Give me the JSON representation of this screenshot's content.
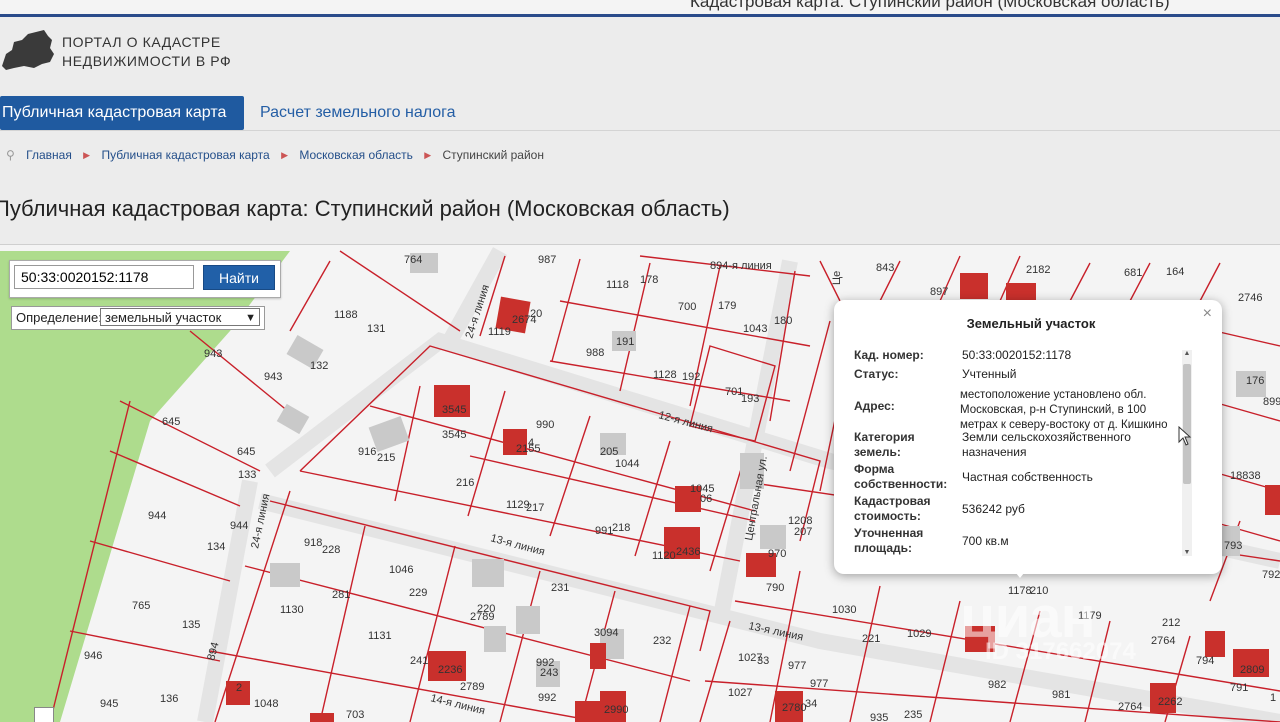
{
  "topbar": {
    "cut_text": "Кадастровая карта: Ступинский район (Московская область)"
  },
  "portal": {
    "line1": "ПОРТАЛ О КАДАСТРЕ",
    "line2": "НЕДВИЖИМОСТИ В РФ"
  },
  "nav": {
    "tabs": [
      {
        "label": "Публичная кадастровая карта",
        "active": true
      },
      {
        "label": "Расчет земельного налога",
        "active": false
      }
    ]
  },
  "breadcrumbs": [
    "Главная",
    "Публичная кадастровая карта",
    "Московская область",
    "Ступинский район"
  ],
  "page_title": "Публичная кадастровая карта: Ступинский район (Московская область)",
  "search": {
    "value": "50:33:0020152:1178",
    "button_label": "Найти"
  },
  "definition": {
    "label": "Определение:",
    "selected": "земельный участок"
  },
  "popup": {
    "title": "Земельный участок",
    "close": "×",
    "rows": [
      {
        "key": "Кад. номер:",
        "value": "50:33:0020152:1178"
      },
      {
        "key": "Статус:",
        "value": "Учтенный"
      },
      {
        "key": "Адрес:",
        "value": "местоположение установлено обл. Московская, р-н Ступинский, в 100 метрах к северу-востоку от д. Кишкино"
      },
      {
        "key": "Категория земель:",
        "value": "Земли сельскохозяйственного назначения"
      },
      {
        "key": "Форма собственности:",
        "value": "Частная собственность"
      },
      {
        "key": "Кадастровая стоимость:",
        "value": "536242 руб"
      },
      {
        "key": "Уточненная площадь:",
        "value": "700 кв.м"
      }
    ]
  },
  "map": {
    "streets": [
      "24-я линия",
      "24-я линия",
      "12-я линия",
      "13-я линия",
      "13-я линия",
      "14-я линия",
      "Центральная ул.",
      "894-я линия",
      "Це"
    ],
    "labels": [
      "764",
      "987",
      "1118",
      "178",
      "894-я линия",
      "843",
      "897",
      "2182",
      "681",
      "164",
      "1188",
      "131",
      "2674",
      "1119",
      "20",
      "988",
      "191",
      "700",
      "179",
      "180",
      "1043",
      "2746",
      "943",
      "132",
      "943",
      "1128",
      "192",
      "701",
      "193",
      "176",
      "899",
      "645",
      "645",
      "133",
      "916",
      "215",
      "3545",
      "3545",
      "990",
      "2155",
      "4",
      "205",
      "1044",
      "1045",
      "06",
      "216",
      "1129",
      "217",
      "991",
      "218",
      "1120",
      "2436",
      "18838",
      "944",
      "944",
      "134",
      "918",
      "228",
      "1046",
      "229",
      "281",
      "231",
      "1208",
      "207",
      "970",
      "790",
      "793",
      "765",
      "135",
      "1130",
      "220",
      "2789",
      "3094",
      "232",
      "1030",
      "221",
      "1029",
      "1178",
      "210",
      "1179",
      "212",
      "792",
      "946",
      "1131",
      "241",
      "2236",
      "2789",
      "992",
      "243",
      "1027",
      "977",
      "2764",
      "794",
      "2809",
      "945",
      "136",
      "1048",
      "703",
      "992",
      "2990",
      "2780",
      "1027",
      "33",
      "977",
      "34",
      "935",
      "235",
      "982",
      "981",
      "2764",
      "2262",
      "791",
      "894",
      "2",
      "1"
    ]
  },
  "watermark": {
    "brand": "циан",
    "id": "ID 317662074"
  },
  "colors": {
    "accent": "#1f5aa0",
    "parcel_border": "#c8202a",
    "building": "#c9302c",
    "park": "#a9d98a"
  }
}
